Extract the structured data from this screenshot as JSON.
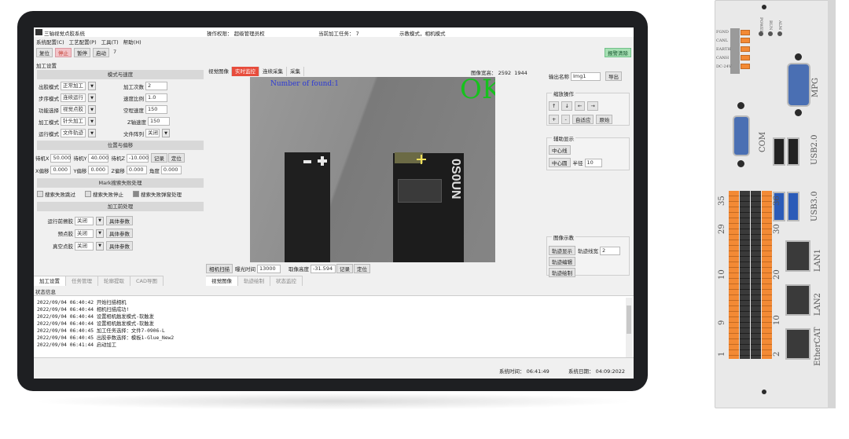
{
  "window": {
    "title": "三轴视觉点胶系统",
    "operator_label": "操作权限： 超级管理员权",
    "task_label": "当前加工任务： 7",
    "mode_label": "示教模式，相机模式"
  },
  "menu": [
    "系统配置(C)",
    "工艺配置(P)",
    "工具(T)",
    "帮助(H)"
  ],
  "toolbar": {
    "reset": "复位",
    "stop": "停止",
    "pause": "暂停",
    "start": "启动",
    "count": "7",
    "alarm_clear": "报警清除"
  },
  "left": {
    "header": "加工设置",
    "sec_mode": "模式与速度",
    "dispense_mode_label": "出胶模式",
    "dispense_mode_value": "正常加工",
    "count_label": "加工次数",
    "count_value": "2",
    "step_mode_label": "步序模式",
    "step_mode_value": "连续运行",
    "speed_ratio_label": "速度比例",
    "speed_ratio_value": "1.0",
    "func_label": "功能选择",
    "func_value": "视觉点胶",
    "idle_speed_label": "空程速度",
    "idle_speed_value": "150",
    "proc_mode_label": "加工模式",
    "proc_mode_value": "针头加工",
    "z_speed_label": "Z轴速度",
    "z_speed_value": "150",
    "run_mode_label": "运行模式",
    "run_mode_value": "文件轨迹",
    "file_array_label": "文件阵列",
    "file_array_value": "关闭",
    "sec_pos": "位置与偏移",
    "wx_label": "待机X",
    "wx_value": "50.000",
    "wy_label": "待机Y",
    "wy_value": "40.000",
    "wz_label": "待机Z",
    "wz_value": "-10.000",
    "record_btn": "记录",
    "locate_btn": "定位",
    "ox_label": "X偏移",
    "ox_value": "0.000",
    "oy_label": "Y偏移",
    "oy_value": "0.000",
    "oz_label": "Z偏移",
    "oz_value": "0.000",
    "angle_label": "角度",
    "angle_value": "0.000",
    "sec_mark": "Mark搜索失败处理",
    "mark_opt1": "搜索失败跳过",
    "mark_opt2": "搜索失败停止",
    "mark_opt3": "搜索失败弹窗处理",
    "sec_pre": "加工前处理",
    "pre1_label": "运行前擦胶",
    "pre1_value": "关闭",
    "pre2_label": "预点胶",
    "pre2_value": "关闭",
    "pre3_label": "真空点胶",
    "pre3_value": "关闭",
    "param_btn": "具体参数",
    "tabs": [
      "加工设置",
      "任务管理",
      "轮廓提取",
      "CAD导图"
    ]
  },
  "center": {
    "tabs": [
      "视觉图像",
      "实时监控",
      "连续采集",
      "采集"
    ],
    "image_size_label": "图像宽高： 2592  1944",
    "overlay_found": "Number of found:1",
    "overlay_ok": "OK",
    "chip_text": "0S0UN",
    "scan_btn": "相机扫描",
    "exposure_label": "曝光时间",
    "exposure_value": "13000",
    "height_label": "取像高度",
    "height_value": "-31.594",
    "record_btn": "记录",
    "locate_btn": "定位",
    "bottom_tabs": [
      "视觉图像",
      "轨迹绘制",
      "状态监控"
    ]
  },
  "right": {
    "output_label": "输出名称",
    "output_value": "Img1",
    "export_btn": "导出",
    "zoom_title": "缩放操作",
    "zoom_btns": [
      "↑",
      "↓",
      "←",
      "→"
    ],
    "zoom_btns2": [
      "+",
      "-",
      "自适应",
      "原始"
    ],
    "aux_title": "辅助显示",
    "center_line_btn": "中心线",
    "center_circle_btn": "中心圆",
    "radius_label": "半径",
    "radius_value": "10",
    "img_title": "图像示教",
    "track_show_btn": "轨迹显示",
    "line_width_label": "轨迹线宽",
    "line_width_value": "2",
    "track_edit_btn": "轨迹编辑",
    "track_draw_btn": "轨迹绘制"
  },
  "status": {
    "title": "状态信息",
    "log": [
      "2022/09/04 06:40:42  开始扫描相机",
      "2022/09/04 06:40:44  相机扫描成功!",
      "2022/09/04 06:40:44  设置相机触发模式-软触发",
      "2022/09/04 06:40:44  设置相机触发模式-软触发",
      "2022/09/04 06:40:45  加工任务选择：文件7-0906-L",
      "2022/09/04 06:40:45  出胶参数选择：模板1-Glue_New2",
      "2022/09/04 06:41:44  启动加工"
    ],
    "sys_time": "系统时间： 06:41:49",
    "sys_date": "系统日期： 04:09:2022"
  },
  "controller": {
    "power_labels": [
      "FGND",
      "CANL",
      "EARTH",
      "CANH",
      "DC-24V"
    ],
    "led_labels": [
      "POWER",
      "RUN",
      "ALM"
    ],
    "mpg": "MPG",
    "com": "COM",
    "usb2": "USB2.0",
    "usb3": "USB3.0",
    "lan1": "LAN1",
    "lan2": "LAN2",
    "ethercat": "EtherCAT",
    "pins_left": [
      "35",
      "29",
      "10",
      "9",
      "1"
    ],
    "pins_mid": [
      "36",
      "30",
      "20",
      "10",
      "2"
    ]
  }
}
